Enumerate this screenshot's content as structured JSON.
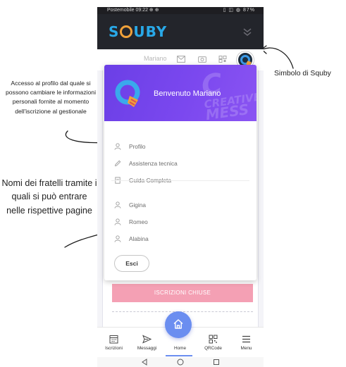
{
  "status_bar": {
    "left_text": "Postemobile 09:22 ⊕ ⊕",
    "right_text": "▯ ◫ ◍ 87%"
  },
  "app": {
    "logo_text_prefix": "S",
    "logo_text_suffix": "UBY"
  },
  "toolbar": {
    "username": "Mariano"
  },
  "dropdown": {
    "welcome": "Benvenuto Mariano",
    "watermark_line1": "C",
    "watermark_line2": "CREATIVE",
    "watermark_line3": "MESS",
    "menu_items": [
      {
        "label": "Profilo",
        "icon": "user-icon"
      },
      {
        "label": "Assistenza tecnica",
        "icon": "pencil-icon"
      },
      {
        "label": "Guida Completa",
        "icon": "document-icon"
      }
    ],
    "siblings": [
      {
        "label": "Gigina",
        "icon": "user-icon"
      },
      {
        "label": "Romeo",
        "icon": "user-icon"
      },
      {
        "label": "Alabina",
        "icon": "user-icon"
      }
    ],
    "exit_label": "Esci"
  },
  "page": {
    "closed_button": "ISCRIZIONI CHIUSE"
  },
  "bottom_nav": [
    {
      "label": "Iscrizioni",
      "icon": "calendar-icon"
    },
    {
      "label": "Messaggi",
      "icon": "send-icon"
    },
    {
      "label": "Home",
      "icon": "home-icon"
    },
    {
      "label": "QRCode",
      "icon": "qrcode-icon"
    },
    {
      "label": "Menu",
      "icon": "menu-icon"
    }
  ],
  "annotations": {
    "profile_note": "Accesso al profilo dal quale si possono cambiare le informazioni personali fornite al momento dell'iscrizione al gestionale",
    "siblings_note": "Nomi dei fratelli tramite i quali si può entrare nelle rispettive pagine",
    "logo_note": "Simbolo di Squby"
  },
  "colors": {
    "header_bg": "#23252b",
    "logo_blue": "#29a9e8",
    "logo_orange": "#f0a13a",
    "dropdown_purple": "#7b48ef",
    "closed_button_pink": "#f4a0b4",
    "home_blue": "#6b8ef0"
  }
}
